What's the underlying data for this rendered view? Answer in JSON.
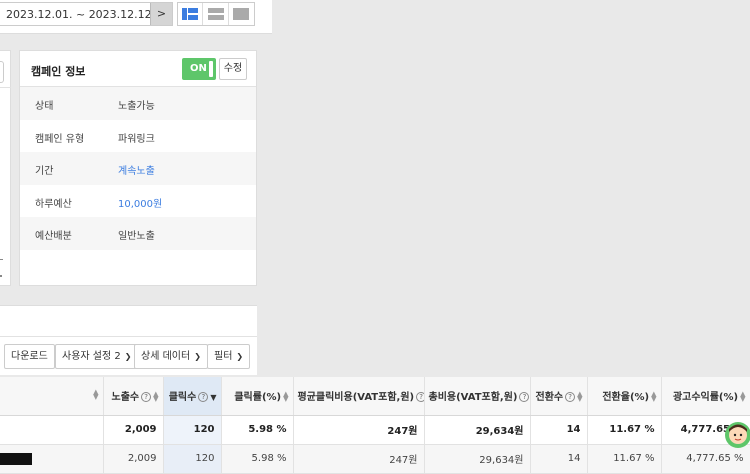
{
  "date_range": {
    "label": "2023.12.01. ~ 2023.12.12.",
    "next_label": ">"
  },
  "view_modes": [
    "grid-view-icon",
    "list-view-icon",
    "single-view-icon"
  ],
  "campaign": {
    "title": "캠페인 정보",
    "toggle_label": "ON",
    "edit_label": "수정",
    "rows": [
      {
        "label": "상태",
        "value": "노출가능"
      },
      {
        "label": "캠페인 유형",
        "value": "파워링크"
      },
      {
        "label": "기간",
        "value": "계속노출"
      },
      {
        "label": "하루예산",
        "value": "10,000원"
      },
      {
        "label": "예산배분",
        "value": "일반노출"
      }
    ]
  },
  "toolbar": {
    "download": "다운로드",
    "user_setting": "사용자 설정 2",
    "detail_data": "상세 데이터",
    "filter": "필터"
  },
  "table": {
    "columns": [
      "노출수",
      "클릭수",
      "클릭률(%)",
      "평균클릭비용(VAT포함,원)",
      "총비용(VAT포함,원)",
      "전환수",
      "전환율(%)",
      "광고수익률(%)"
    ],
    "total_row": [
      "2,009",
      "120",
      "5.98 %",
      "247원",
      "29,634원",
      "14",
      "11.67 %",
      "4,777.65 %"
    ],
    "rows": [
      [
        "2,009",
        "120",
        "5.98 %",
        "247원",
        "29,634원",
        "14",
        "11.67 %",
        "4,777.65 %"
      ]
    ]
  },
  "colors": {
    "toggle_on": "#5ec66a",
    "link": "#3c7de0",
    "active_view": "#3c7de0",
    "sorted_header": "#dfe9f5"
  }
}
